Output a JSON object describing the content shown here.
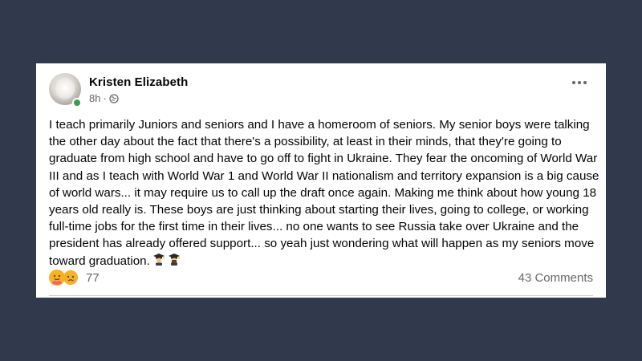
{
  "post": {
    "author": "Kristen Elizabeth",
    "time": "8h",
    "dot": "·",
    "body": "I teach primarily Juniors and seniors and I have a homeroom of seniors. My senior boys were talking the other day about the fact that there's a possibility, at least in their minds, that they're going to graduate from high school and have to go off to fight in Ukraine. They fear the oncoming of World War III and as I teach with World War 1 and World War II nationalism and territory expansion is a big cause of world wars... it may require us to call up the draft once again. Making me think about how young 18 years old really is. These boys are just thinking about starting their lives, going to college, or working full-time jobs for the first time in their lives... no one wants to see Russia take over Ukraine and the president has already offered support... so yeah just wondering what will happen as my seniors move toward graduation.",
    "trailing_emoji": [
      "graduate-emoji",
      "graduate-emoji"
    ]
  },
  "engagement": {
    "reactions": [
      "care-reaction",
      "sad-reaction"
    ],
    "reaction_count": "77",
    "comments": "43 Comments"
  },
  "colors": {
    "background": "#313a4d",
    "card": "#ffffff",
    "online": "#31a24c",
    "secondary_text": "#65676b"
  }
}
